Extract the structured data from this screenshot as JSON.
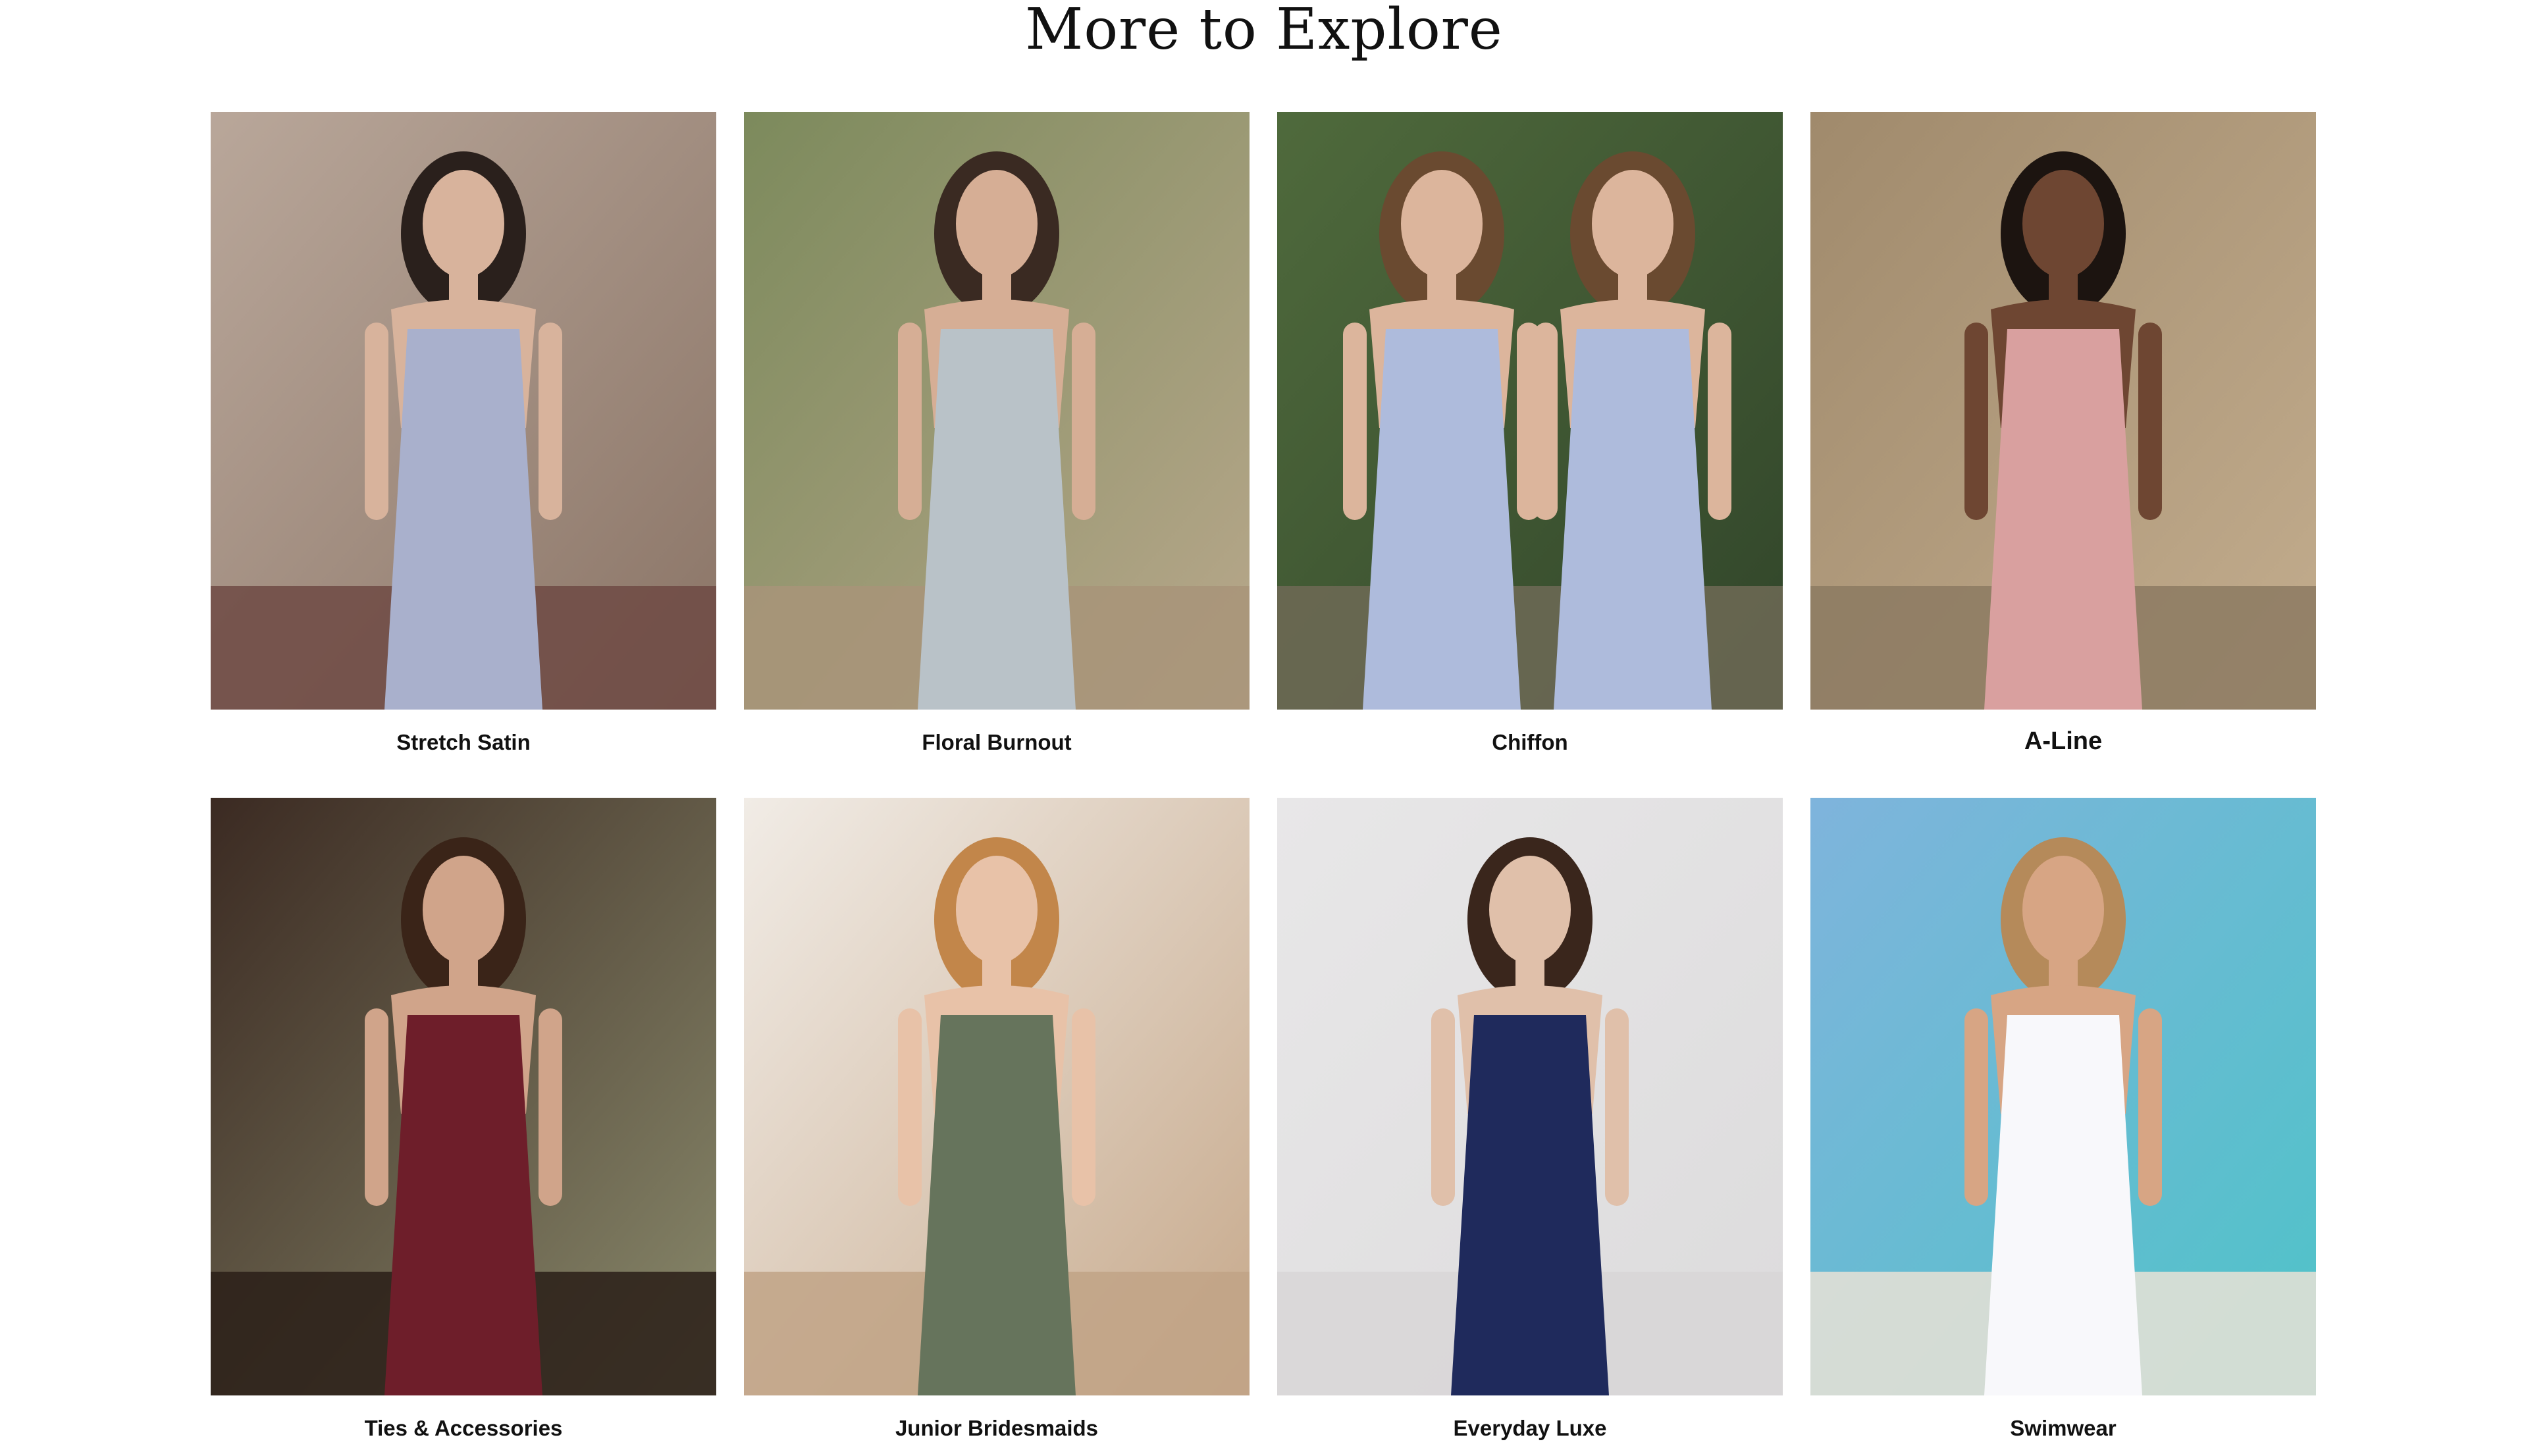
{
  "section": {
    "title": "More to Explore"
  },
  "cards": [
    {
      "label": "Stretch Satin",
      "image": "model-lavender-satin-dress-photo",
      "palette": {
        "bg": "#b9a79a",
        "bg2": "#8a7466",
        "floor": "#6e4a44",
        "dress": "#a9b0cc",
        "hair": "#2a201c",
        "skin": "#d8b39c"
      }
    },
    {
      "label": "Floral Burnout",
      "image": "model-silver-jacquard-dress-photo",
      "palette": {
        "bg": "#7c8a5c",
        "bg2": "#b9a88c",
        "floor": "#a89479",
        "dress": "#b9c2c8",
        "hair": "#3a2a22",
        "skin": "#d6ae95"
      }
    },
    {
      "label": "Chiffon",
      "image": "two-models-periwinkle-dresses-photo",
      "palette": {
        "bg": "#4f6a3c",
        "bg2": "#31452a",
        "floor": "#6e6a56",
        "dress": "#aebbdc",
        "hair": "#6a4a30",
        "skin": "#dcb59c"
      }
    },
    {
      "label": "A-Line",
      "image": "model-blush-one-shoulder-gown-photo",
      "palette": {
        "bg": "#a08a6c",
        "bg2": "#c3ad8e",
        "floor": "#8c7a62",
        "dress": "#d9a09f",
        "hair": "#1c1410",
        "skin": "#6e4632"
      }
    },
    {
      "label": "Ties & Accessories",
      "image": "man-burgundy-suit-photo",
      "palette": {
        "bg": "#3b2a22",
        "bg2": "#8a8a6c",
        "floor": "#2a1e18",
        "dress": "#6e1e2a",
        "hair": "#3a2418",
        "skin": "#d0a48a"
      }
    },
    {
      "label": "Junior Bridesmaids",
      "image": "girl-sage-green-dress-photo",
      "palette": {
        "bg": "#f1ece6",
        "bg2": "#c6a88a",
        "floor": "#c1a386",
        "dress": "#66745c",
        "hair": "#c2864a",
        "skin": "#e8c2a8"
      }
    },
    {
      "label": "Everyday Luxe",
      "image": "model-navy-slip-dress-cape-photo",
      "palette": {
        "bg": "#e8e7e8",
        "bg2": "#dcdbdc",
        "floor": "#d8d6d7",
        "dress": "#1f2a5c",
        "hair": "#3a261c",
        "skin": "#e0c0aa"
      }
    },
    {
      "label": "Swimwear",
      "image": "model-white-swimsuit-beach-photo",
      "palette": {
        "bg": "#7fb4dc",
        "bg2": "#4ec3c8",
        "floor": "#e9e2d6",
        "dress": "#f8f8fb",
        "hair": "#b58a5a",
        "skin": "#d7a584"
      }
    }
  ]
}
